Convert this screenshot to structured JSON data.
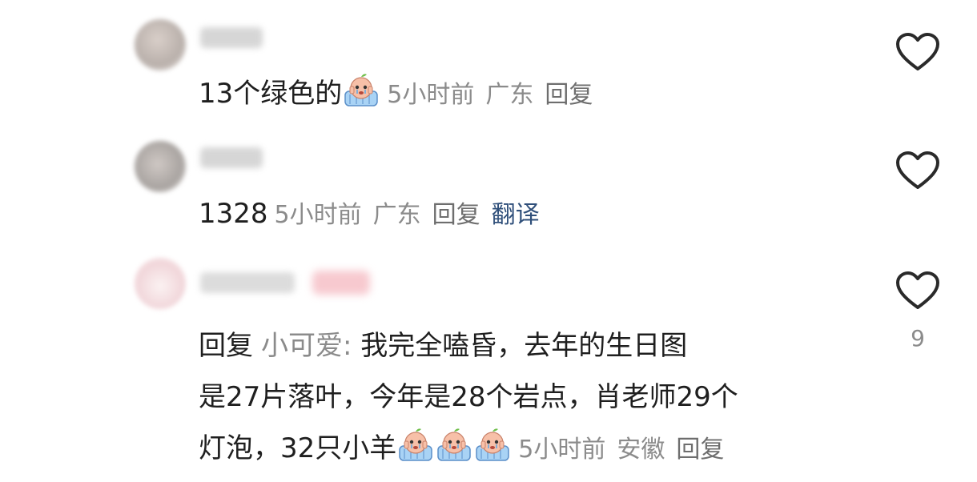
{
  "comments": [
    {
      "text": "13个绿色的",
      "emoji_count": 1,
      "emoji": "crying-baby-emoji",
      "time": "5小时前",
      "location": "广东",
      "reply_label": "回复"
    },
    {
      "text": "1328",
      "time": "5小时前",
      "location": "广东",
      "reply_label": "回复",
      "translate_label": "翻译"
    },
    {
      "reply_prefix": "回复",
      "reply_target": "小可爱:",
      "line1": "我完全嗑昏，去年的生日图",
      "line2": "是27片落叶，今年是28个岩点，肖老师29个",
      "line3": "灯泡，32只小羊",
      "emoji_count": 3,
      "emoji": "crying-baby-emoji",
      "time": "5小时前",
      "location": "安徽",
      "reply_label": "回复",
      "like_count": "9"
    }
  ],
  "colors": {
    "text": "#1f1f1f",
    "meta": "#8b8b8b",
    "translate": "#2f4f7a"
  },
  "icons": {
    "like": "heart-outline-icon"
  }
}
